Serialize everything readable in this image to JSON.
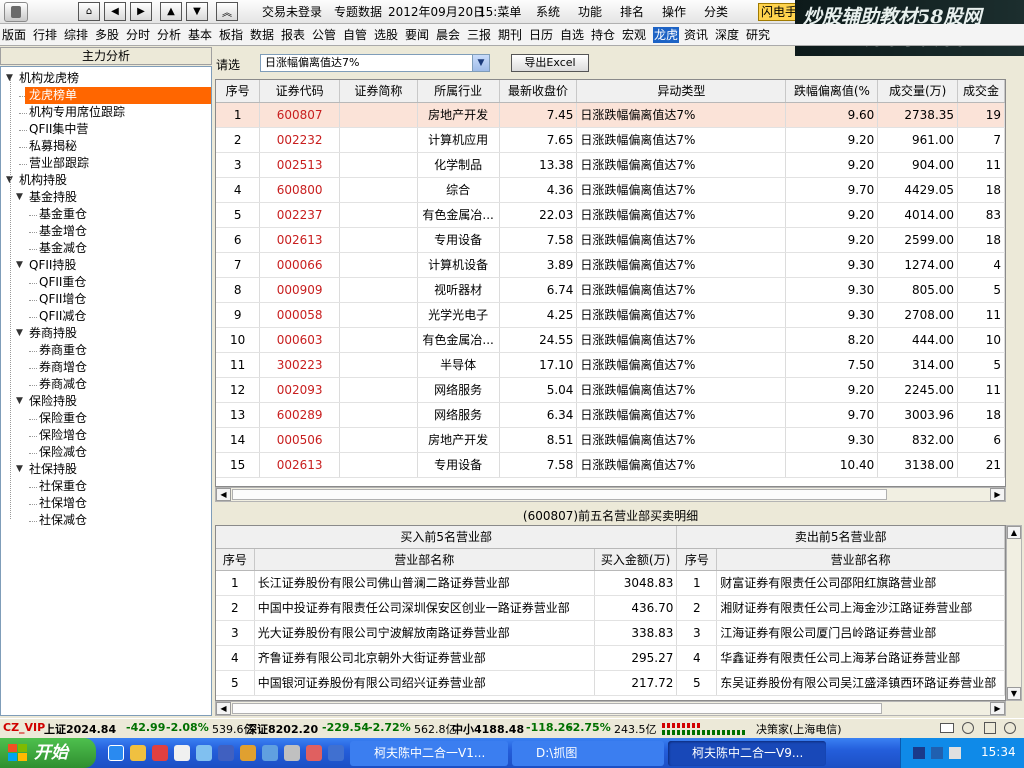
{
  "titlebar": {
    "nav_buttons": [
      "home-icon",
      "arrow-left-icon",
      "arrow-right-icon",
      "arrow-up-icon",
      "arrow-down-icon",
      "double-up-icon"
    ],
    "menu": [
      "交易未登录",
      "专题数据",
      "2012年09月20日",
      "15:菜单",
      "系统",
      "功能",
      "排名",
      "操作",
      "分类"
    ],
    "flash": "闪电手"
  },
  "watermark": {
    "line1": "炒股辅助教材58股网",
    "line2": "www.58Gu.com"
  },
  "menubar": [
    "版面",
    "行排",
    "综排",
    "多股",
    "分时",
    "分析",
    "基本",
    "板指",
    "数据",
    "报表",
    "公管",
    "自管",
    "选股",
    "要闻",
    "晨会",
    "三报",
    "期刊",
    "日历",
    "自选",
    "持仓",
    "宏观",
    "龙虎",
    "资讯",
    "深度",
    "研究"
  ],
  "menubar_active": "龙虎",
  "left": {
    "header": "主力分析",
    "tree": [
      {
        "label": "机构龙虎榜",
        "level": 0,
        "toggle": "▼"
      },
      {
        "label": "龙虎榜单",
        "level": 1,
        "selected": true
      },
      {
        "label": "机构专用席位跟踪",
        "level": 1
      },
      {
        "label": "QFII集中营",
        "level": 1
      },
      {
        "label": "私募揭秘",
        "level": 1
      },
      {
        "label": "营业部跟踪",
        "level": 1
      },
      {
        "label": "机构持股",
        "level": 0,
        "toggle": "▼"
      },
      {
        "label": "基金持股",
        "level": 1,
        "toggle": "▼"
      },
      {
        "label": "基金重仓",
        "level": 2
      },
      {
        "label": "基金增仓",
        "level": 2
      },
      {
        "label": "基金减仓",
        "level": 2
      },
      {
        "label": "QFII持股",
        "level": 1,
        "toggle": "▼"
      },
      {
        "label": "QFII重仓",
        "level": 2
      },
      {
        "label": "QFII增仓",
        "level": 2
      },
      {
        "label": "QFII减仓",
        "level": 2
      },
      {
        "label": "券商持股",
        "level": 1,
        "toggle": "▼"
      },
      {
        "label": "券商重仓",
        "level": 2
      },
      {
        "label": "券商增仓",
        "level": 2
      },
      {
        "label": "券商减仓",
        "level": 2
      },
      {
        "label": "保险持股",
        "level": 1,
        "toggle": "▼"
      },
      {
        "label": "保险重仓",
        "level": 2
      },
      {
        "label": "保险增仓",
        "level": 2
      },
      {
        "label": "保险减仓",
        "level": 2
      },
      {
        "label": "社保持股",
        "level": 1,
        "toggle": "▼"
      },
      {
        "label": "社保重仓",
        "level": 2
      },
      {
        "label": "社保增仓",
        "level": 2
      },
      {
        "label": "社保减仓",
        "level": 2
      }
    ]
  },
  "filter": {
    "label": "请选",
    "value": "日涨幅偏离值达7%",
    "export": "导出Excel"
  },
  "main_table": {
    "columns": [
      "序号",
      "证券代码",
      "证券简称",
      "所属行业",
      "最新收盘价",
      "异动类型",
      "跌幅偏离值(%",
      "成交量(万)",
      "成交金"
    ],
    "rows": [
      [
        "1",
        "600807",
        "",
        "房地产开发",
        "7.45",
        "日涨跌幅偏离值达7%",
        "9.60",
        "2738.35",
        "19"
      ],
      [
        "2",
        "002232",
        "",
        "计算机应用",
        "7.65",
        "日涨跌幅偏离值达7%",
        "9.20",
        "961.00",
        "7"
      ],
      [
        "3",
        "002513",
        "",
        "化学制品",
        "13.38",
        "日涨跌幅偏离值达7%",
        "9.20",
        "904.00",
        "11"
      ],
      [
        "4",
        "600800",
        "",
        "综合",
        "4.36",
        "日涨跌幅偏离值达7%",
        "9.70",
        "4429.05",
        "18"
      ],
      [
        "5",
        "002237",
        "",
        "有色金属冶...",
        "22.03",
        "日涨跌幅偏离值达7%",
        "9.20",
        "4014.00",
        "83"
      ],
      [
        "6",
        "002613",
        "",
        "专用设备",
        "7.58",
        "日涨跌幅偏离值达7%",
        "9.20",
        "2599.00",
        "18"
      ],
      [
        "7",
        "000066",
        "",
        "计算机设备",
        "3.89",
        "日涨跌幅偏离值达7%",
        "9.30",
        "1274.00",
        "4"
      ],
      [
        "8",
        "000909",
        "",
        "视听器材",
        "6.74",
        "日涨跌幅偏离值达7%",
        "9.30",
        "805.00",
        "5"
      ],
      [
        "9",
        "000058",
        "",
        "光学光电子",
        "4.25",
        "日涨跌幅偏离值达7%",
        "9.30",
        "2708.00",
        "11"
      ],
      [
        "10",
        "000603",
        "",
        "有色金属冶...",
        "24.55",
        "日涨跌幅偏离值达7%",
        "8.20",
        "444.00",
        "10"
      ],
      [
        "11",
        "300223",
        "",
        "半导体",
        "17.10",
        "日涨跌幅偏离值达7%",
        "7.50",
        "314.00",
        "5"
      ],
      [
        "12",
        "002093",
        "",
        "网络服务",
        "5.04",
        "日涨跌幅偏离值达7%",
        "9.20",
        "2245.00",
        "11"
      ],
      [
        "13",
        "600289",
        "",
        "网络服务",
        "6.34",
        "日涨跌幅偏离值达7%",
        "9.70",
        "3003.96",
        "18"
      ],
      [
        "14",
        "000506",
        "",
        "房地产开发",
        "8.51",
        "日涨跌幅偏离值达7%",
        "9.30",
        "832.00",
        "6"
      ],
      [
        "15",
        "002613",
        "",
        "专用设备",
        "7.58",
        "日涨跌幅偏离值达7%",
        "10.40",
        "3138.00",
        "21"
      ]
    ]
  },
  "detail": {
    "title": "(600807)前五名营业部买卖明细",
    "buy_header": "买入前5名营业部",
    "sell_header": "卖出前5名营业部",
    "columns": [
      "序号",
      "营业部名称",
      "买入金额(万)",
      "序号",
      "营业部名称"
    ],
    "rows": [
      [
        "1",
        "长江证券股份有限公司佛山普澜二路证券营业部",
        "3048.83",
        "1",
        "财富证券有限责任公司邵阳红旗路营业部"
      ],
      [
        "2",
        "中国中投证券有限责任公司深圳保安区创业一路证券营业部",
        "436.70",
        "2",
        "湘财证券有限责任公司上海金沙江路证券营业部"
      ],
      [
        "3",
        "光大证券股份有限公司宁波解放南路证券营业部",
        "338.83",
        "3",
        "江海证券有限公司厦门吕岭路证券营业部"
      ],
      [
        "4",
        "齐鲁证券有限公司北京朝外大街证券营业部",
        "295.27",
        "4",
        "华鑫证券有限责任公司上海茅台路证券营业部"
      ],
      [
        "5",
        "中国银河证券股份有限公司绍兴证券营业部",
        "217.72",
        "5",
        "东吴证券股份有限公司吴江盛泽镇西环路证券营业部"
      ]
    ]
  },
  "status": {
    "cz_vip": "CZ_VIP",
    "sh": "上证2024.84",
    "sh_chg": "-42.99",
    "sh_pct": "-2.08%",
    "sh_vol": "539.6亿",
    "sz": "深证8202.20",
    "sz_chg": "-229.54",
    "sz_pct": "-2.72%",
    "sz_vol": "562.8亿",
    "zx": "中小4188.48",
    "zx_chg": "-118.26",
    "zx_pct": "-2.75%",
    "zx_vol": "243.5亿",
    "server": "决策家(上海电信)"
  },
  "taskbar": {
    "start": "开始",
    "tasks": [
      "柯夫陈中二合一V1...",
      "D:\\抓图",
      "柯夫陈中二合一V9..."
    ],
    "clock": "15:34"
  },
  "colors": {
    "selected_row": "#fbe3d8",
    "code_red": "#c81e1e",
    "tree_selected": "#ff6600",
    "down_green": "#007000"
  }
}
